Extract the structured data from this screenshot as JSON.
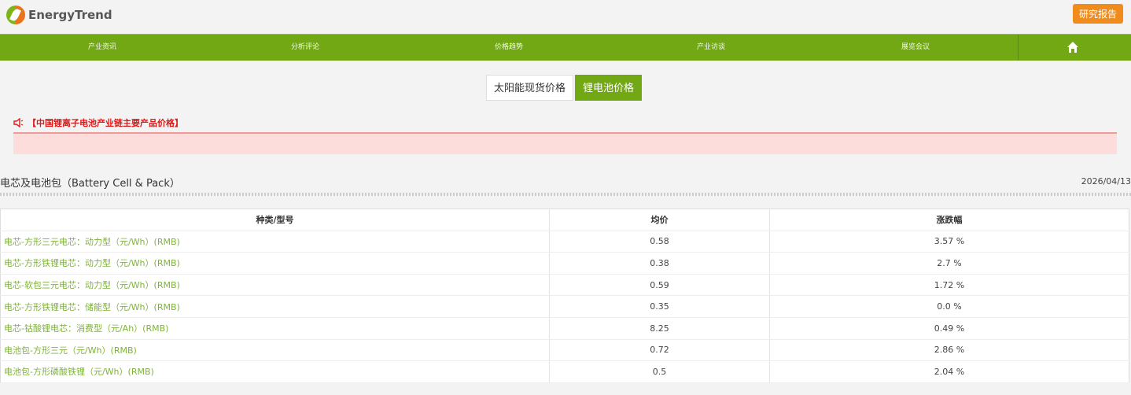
{
  "header": {
    "logo_text": "EnergyTrend",
    "report_button": "研究报告"
  },
  "nav": {
    "items": [
      "产业资讯",
      "分析评论",
      "价格趋势",
      "产业访谈",
      "展览会议"
    ],
    "home_icon": "home-icon"
  },
  "tabs": [
    {
      "label": "太阳能现货价格",
      "active": false
    },
    {
      "label": "锂电池价格",
      "active": true
    }
  ],
  "notice": {
    "title": "【中国锂离子电池产业链主要产品价格】"
  },
  "section": {
    "title": "电芯及电池包（Battery Cell & Pack）",
    "date": "2026/04/13"
  },
  "table": {
    "headers": [
      "种类/型号",
      "均价",
      "涨跌幅"
    ],
    "rows": [
      {
        "name": "电芯-方形三元电芯：动力型（元/Wh）(RMB)",
        "price": "0.58",
        "change": "3.57 %"
      },
      {
        "name": "电芯-方形铁锂电芯：动力型（元/Wh）(RMB)",
        "price": "0.38",
        "change": "2.7 %"
      },
      {
        "name": "电芯-软包三元电芯：动力型（元/Wh）(RMB)",
        "price": "0.59",
        "change": "1.72 %"
      },
      {
        "name": "电芯-方形铁锂电芯：储能型（元/Wh）(RMB)",
        "price": "0.35",
        "change": "0.0 %"
      },
      {
        "name": "电芯-钴酸锂电芯：消费型（元/Ah）(RMB)",
        "price": "8.25",
        "change": "0.49 %"
      },
      {
        "name": "电池包-方形三元（元/Wh）(RMB)",
        "price": "0.72",
        "change": "2.86 %"
      },
      {
        "name": "电池包-方形磷酸铁锂（元/Wh）(RMB)",
        "price": "0.5",
        "change": "2.04 %"
      }
    ]
  },
  "colors": {
    "brand_green": "#72a814",
    "orange": "#f08c1e",
    "notice_red": "#e01818"
  }
}
